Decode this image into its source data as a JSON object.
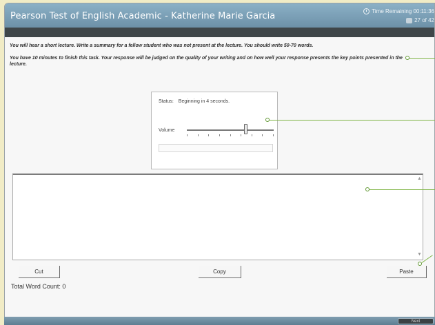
{
  "window": {
    "title": "Pearson Test of English Academic - Katherine Marie Garcia",
    "timer_label": "Time Remaining 00:11:36",
    "progress_label": "27 of 42"
  },
  "instructions": {
    "line1": "You will hear a short lecture. Write a summary for a fellow student who was not present at the lecture. You should write 50-70 words.",
    "line2": "You have 10 minutes to finish this task. Your response will be judged on the quality of your writing and on how well your response presents the key points presented in the lecture."
  },
  "player": {
    "status_label": "Status:",
    "status_value": "Beginning in 4 seconds.",
    "volume_label": "Volume",
    "volume_level": 0.68
  },
  "answer": {
    "value": "",
    "placeholder": ""
  },
  "buttons": {
    "cut": "Cut",
    "copy": "Copy",
    "paste": "Paste"
  },
  "word_count": {
    "label": "Total Word Count: 0"
  },
  "footer": {
    "next": "Next"
  },
  "colors": {
    "titlebar": "#7b9fb7",
    "darkbar": "#3f4649",
    "background": "#f1ecc6",
    "callout": "#7cb342"
  },
  "icons": [
    "clock-icon",
    "progress-icon",
    "scroll-up-icon",
    "scroll-down-icon"
  ]
}
